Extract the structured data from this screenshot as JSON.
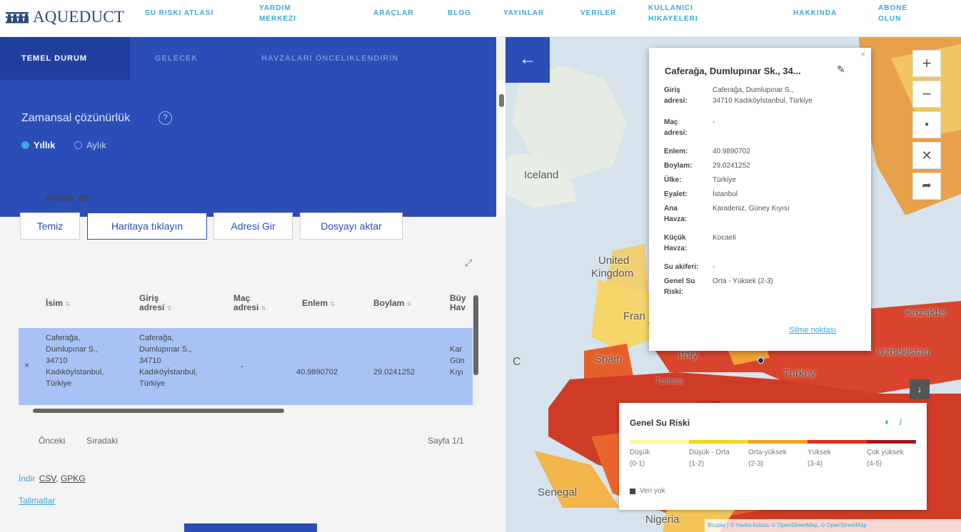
{
  "header": {
    "logo_text": "AQUEDUCT",
    "nav": [
      {
        "label1": "SU RISKI ATLASI",
        "label2": ""
      },
      {
        "label1": "YARDIM",
        "label2": "MERKEZI"
      },
      {
        "label1": "ARAÇLAR",
        "label2": ""
      },
      {
        "label1": "BLOG",
        "label2": ""
      },
      {
        "label1": "YAYINLAR",
        "label2": ""
      },
      {
        "label1": "VERILER",
        "label2": ""
      },
      {
        "label1": "KULLANICI",
        "label2": "HIKAYELERI"
      },
      {
        "label1": "HAKKINDA",
        "label2": ""
      },
      {
        "label1": "ABONE",
        "label2": "OLUN"
      }
    ]
  },
  "tabs": [
    "TEMEL DURUM",
    "GELECEK",
    "HAVZALARI ÖNCELIKLENDIRIN"
  ],
  "temporal": {
    "title": "Zamansal çözünürlük",
    "help": "?",
    "options": [
      "Yıllık",
      "Aylık"
    ],
    "selected": "Yıllık"
  },
  "analyze": {
    "title": "Analiz et",
    "buttons": [
      "Temiz",
      "Haritaya tıklayın",
      "Adresi Gir",
      "Dosyayı aktar"
    ],
    "active_button": "Haritaya tıklayın"
  },
  "table": {
    "columns": [
      {
        "line1": "İsim",
        "line2": ""
      },
      {
        "line1": "Giriş",
        "line2": "adresi"
      },
      {
        "line1": "Maç",
        "line2": "adresi"
      },
      {
        "line1": "Enlem",
        "line2": ""
      },
      {
        "line1": "Boylam",
        "line2": ""
      },
      {
        "line1": "Büy",
        "line2": "Hav"
      }
    ],
    "row": {
      "remove": "×",
      "name": [
        "Caferağa,",
        "Dumlupınar S.,",
        "34710",
        "Kadıköyİstanbul,",
        "Türkiye"
      ],
      "input_address": [
        "Caferağa,",
        "Dumlupınar S.,",
        "34710",
        "Kadıköyİstanbul,",
        "Türkiye"
      ],
      "match_address": "-",
      "lat": "40.9890702",
      "lon": "29.0241252",
      "basin": [
        "Kar",
        "Gün",
        "Kıyı"
      ]
    }
  },
  "pagination": {
    "prev": "Önceki",
    "next": "Sıradaki",
    "page": "Sayfa 1/1"
  },
  "download": {
    "label": "İndir",
    "csv": "CSV",
    "gpkg": "GPKG"
  },
  "instructions": "Talimatlar",
  "map": {
    "labels": [
      "Iceland",
      "United",
      "Kingdom",
      "Fran",
      "Spain",
      "Italy",
      "Turkey",
      "Kazakhs",
      "Uzbekistan",
      "Tunisia",
      "Senegal",
      "Nigeria",
      "C"
    ],
    "controls": [
      "+",
      "−",
      "●",
      "✕",
      "➦"
    ]
  },
  "popup": {
    "title": "Caferağa, Dumlupınar Sk., 34...",
    "rows": [
      {
        "key": [
          "Giriş",
          "adresi:"
        ],
        "value": [
          "Caferağa, Dumlupınar S.,",
          "34710 Kadıköyİstanbul, Türkiye"
        ]
      },
      {
        "key": [
          "Maç",
          "adresi:"
        ],
        "value": [
          "-"
        ]
      },
      {
        "key": [
          "Enlem:"
        ],
        "value": [
          "40.9890702"
        ]
      },
      {
        "key": [
          "Boylam:"
        ],
        "value": [
          "29.0241252"
        ]
      },
      {
        "key": [
          "Ülke:"
        ],
        "value": [
          "Türkiye"
        ]
      },
      {
        "key": [
          "Eyalet:"
        ],
        "value": [
          "İstanbul"
        ]
      },
      {
        "key": [
          "Ana",
          "Havza:"
        ],
        "value": [
          "Karadeniz, Güney Kıyısı"
        ]
      },
      {
        "key": [
          "Küçük",
          "Havza:"
        ],
        "value": [
          "Kocaeli"
        ]
      },
      {
        "key": [
          "Su akiferi:"
        ],
        "value": [
          "-"
        ]
      },
      {
        "key": [
          "Genel Su",
          "Riski:"
        ],
        "value": [
          "Orta - Yüksek (2-3)"
        ]
      }
    ],
    "delete": "Silme noktası",
    "close": "×"
  },
  "legend": {
    "title": "Genel Su Riski",
    "items": [
      {
        "label": "Düşük",
        "range": "(0-1)",
        "color": "#fef79d"
      },
      {
        "label": "Düşük - Orta",
        "range": "(1-2)",
        "color": "#f4d41f"
      },
      {
        "label": "Orta-yüksek",
        "range": "(2-3)",
        "color": "#f7a21c"
      },
      {
        "label": "Yüksek",
        "range": "(3-4)",
        "color": "#e4301d"
      },
      {
        "label": "Çok yüksek",
        "range": "(4-5)",
        "color": "#9e1a1a"
      }
    ],
    "nodata": "Veri yok"
  },
  "credits": "Bruşlar | © Harita kutusu © OpenStreetMap, © OpenStreetMap"
}
